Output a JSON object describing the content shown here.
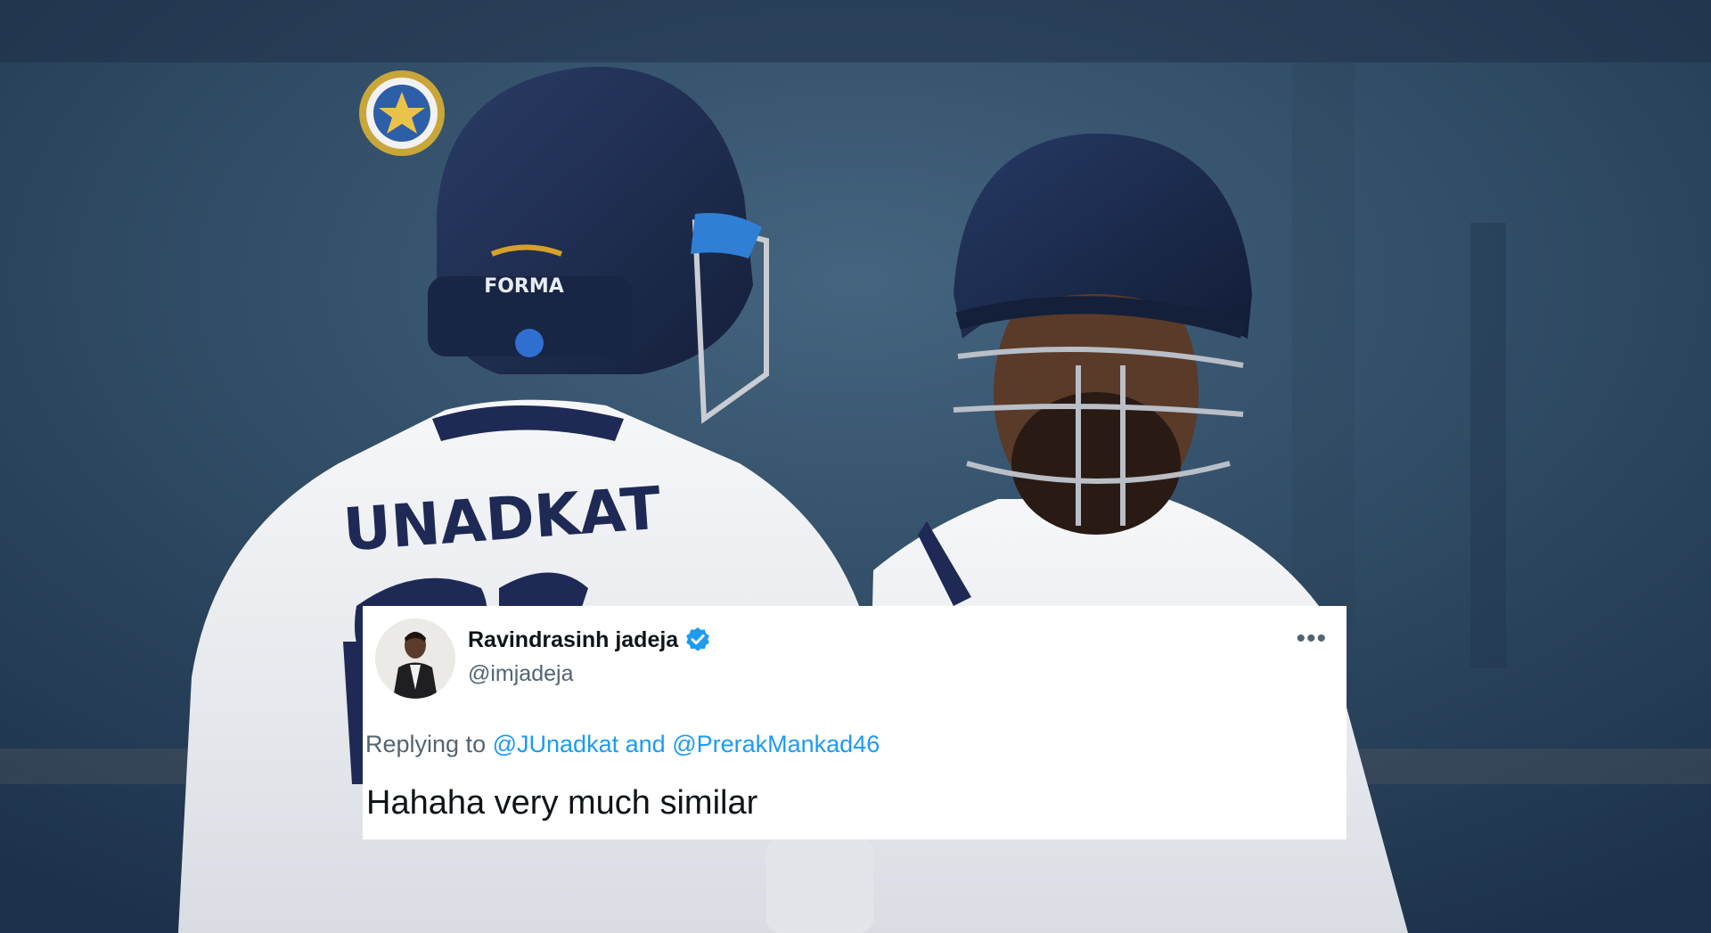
{
  "background": {
    "jersey_name": "UNADKAT",
    "helmet_brand": "FORMA",
    "logo_icon": "bcci-crest-icon"
  },
  "tweet": {
    "author_name": "Ravindrasinh jadeja",
    "author_handle": "@imjadeja",
    "verified": true,
    "more_icon": "more-options-icon",
    "replying_prefix": "Replying to",
    "mention_1": "@JUnadkat",
    "and_text": "and",
    "mention_2": "@PrerakMankad46",
    "text": "Hahaha very much similar"
  },
  "colors": {
    "verified_blue": "#1d9bf0",
    "mention_blue": "#1d9bf0",
    "text_primary": "#0f1419",
    "text_secondary": "#536471",
    "helmet_navy": "#1b2a4e",
    "jersey_white": "#f3f4f6"
  }
}
